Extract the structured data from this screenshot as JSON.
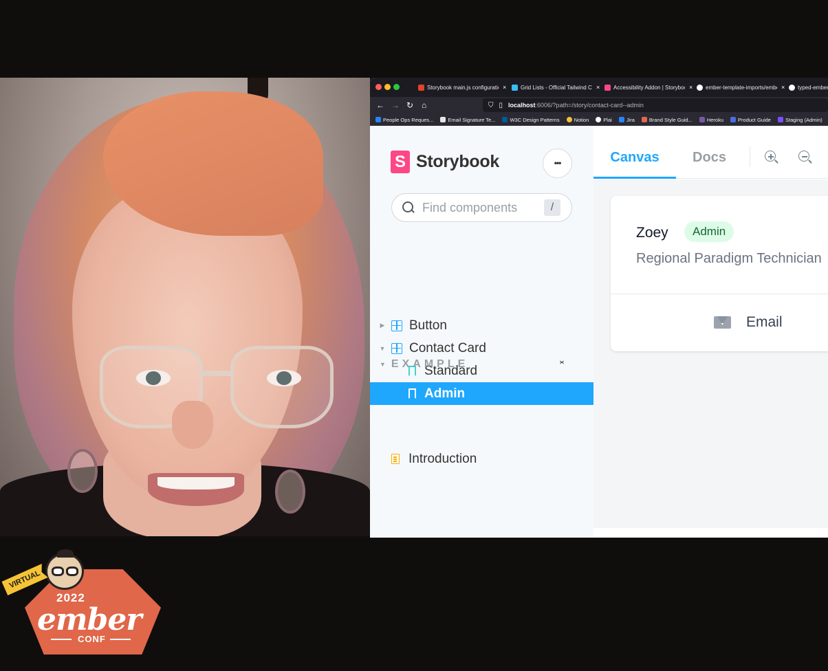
{
  "browser": {
    "tabs": [
      {
        "title": "Storybook main.js configuratio",
        "color": "#e24329"
      },
      {
        "title": "Grid Lists - Official Tailwind CS",
        "color": "#38bdf8"
      },
      {
        "title": "Accessibility Addon | Storybook",
        "color": "#ff4785"
      },
      {
        "title": "ember-template-imports/embe",
        "color": "#ffffff"
      },
      {
        "title": "typed-ember",
        "color": "#ffffff"
      }
    ],
    "close_glyph": "×",
    "url": {
      "host": "localhost",
      "rest": ":6006/?path=/story/contact-card--admin"
    },
    "bookmarks": [
      {
        "label": "People Ops Reques...",
        "color": "#2684ff"
      },
      {
        "label": "Email Signature Te...",
        "color": "#e5e5e5"
      },
      {
        "label": "W3C Design Patterns",
        "color": "#005a9c"
      },
      {
        "label": "Notion",
        "color": "#f5c335"
      },
      {
        "label": "Plai",
        "color": "#ffffff"
      },
      {
        "label": "Jira",
        "color": "#2684ff"
      },
      {
        "label": "Brand Style Guid...",
        "color": "#e0674a"
      },
      {
        "label": "Heroku",
        "color": "#79589f"
      },
      {
        "label": "Product Guide",
        "color": "#4a6ee0"
      },
      {
        "label": "Staging (Admin)",
        "color": "#7c4dff"
      }
    ]
  },
  "storybook": {
    "logo_mark": "S",
    "brand": "Storybook",
    "menu_glyph": "•••",
    "search": {
      "placeholder": "Find components",
      "shortcut": "/"
    },
    "tree": {
      "button": "Button",
      "contact_card": "Contact Card",
      "standard": "Standard",
      "admin": "Admin"
    },
    "group": {
      "title": "EXAMPLE",
      "introduction": "Introduction"
    },
    "toolbar": {
      "canvas": "Canvas",
      "docs": "Docs"
    },
    "card": {
      "name": "Zoey",
      "badge": "Admin",
      "role": "Regional Paradigm Technician",
      "email": "Email"
    }
  },
  "logo": {
    "ribbon": "VIRTUAL",
    "year": "2022",
    "word": "ember",
    "conf": "CONF"
  },
  "colors": {
    "storybook_accent": "#1ea7fd",
    "storybook_pink": "#ff4785",
    "badge_bg": "#dcfce7",
    "badge_text": "#166534",
    "ember_orange": "#e0674a"
  }
}
